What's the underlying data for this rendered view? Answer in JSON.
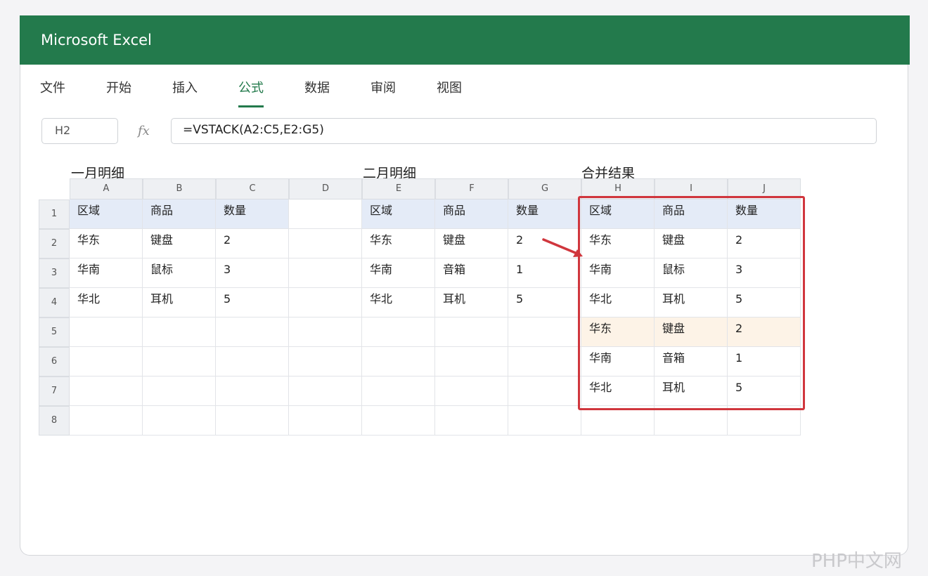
{
  "app": {
    "title": "Microsoft Excel"
  },
  "ribbon": {
    "tabs": [
      {
        "label": "文件"
      },
      {
        "label": "开始"
      },
      {
        "label": "插入"
      },
      {
        "label": "公式"
      },
      {
        "label": "数据"
      },
      {
        "label": "审阅"
      },
      {
        "label": "视图"
      }
    ],
    "active_tab": "公式"
  },
  "formula_bar": {
    "cell_ref": "H2",
    "fx": "fx",
    "formula": "=VSTACK(A2:C5,E2:G5)"
  },
  "sections": [
    {
      "label": "一月明细"
    },
    {
      "label": "二月明细"
    },
    {
      "label": "合并结果"
    }
  ],
  "grid": {
    "columns": [
      "A",
      "B",
      "C",
      "D",
      "E",
      "F",
      "G",
      "H",
      "I",
      "J"
    ],
    "row_numbers": [
      "1",
      "2",
      "3",
      "4",
      "5",
      "6",
      "7",
      "8"
    ],
    "rows": [
      [
        "区域",
        "商品",
        "数量",
        "",
        "区域",
        "商品",
        "数量",
        "区域",
        "商品",
        "数量"
      ],
      [
        "华东",
        "键盘",
        "2",
        "",
        "华东",
        "键盘",
        "2",
        "华东",
        "键盘",
        "2"
      ],
      [
        "华南",
        "鼠标",
        "3",
        "",
        "华南",
        "音箱",
        "1",
        "华南",
        "鼠标",
        "3"
      ],
      [
        "华北",
        "耳机",
        "5",
        "",
        "华北",
        "耳机",
        "5",
        "华北",
        "耳机",
        "5"
      ],
      [
        "",
        "",
        "",
        "",
        "",
        "",
        "",
        "华东",
        "键盘",
        "2"
      ],
      [
        "",
        "",
        "",
        "",
        "",
        "",
        "",
        "华南",
        "音箱",
        "1"
      ],
      [
        "",
        "",
        "",
        "",
        "",
        "",
        "",
        "华北",
        "耳机",
        "5"
      ],
      [
        "",
        "",
        "",
        "",
        "",
        "",
        "",
        "",
        "",
        ""
      ]
    ]
  },
  "colors": {
    "brand": "#237a4c",
    "highlight_box": "#d0363d",
    "header_fill": "#e4ebf7",
    "stack_row_fill": "#fdf3e7"
  },
  "watermark": "PHP中文网"
}
